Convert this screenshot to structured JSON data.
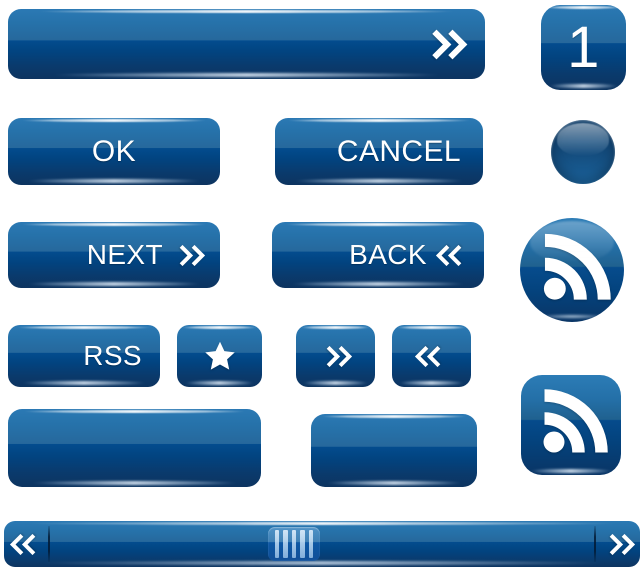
{
  "banner": {
    "label": "",
    "icon": "double-chevron-right-icon"
  },
  "buttons": {
    "ok": "OK",
    "cancel": "CANCEL",
    "next": "NEXT",
    "back": "BACK",
    "rss": "RSS",
    "star_icon": "star-icon",
    "forward_icon": "double-chevron-right-icon",
    "rewind_icon": "double-chevron-left-icon",
    "blank_wide": "",
    "blank_small": ""
  },
  "badge": {
    "number": "1"
  },
  "orb": {
    "label": "",
    "icon": "glossy-sphere-icon"
  },
  "rss_round": {
    "icon": "rss-feed-icon"
  },
  "rss_square": {
    "icon": "rss-feed-icon"
  },
  "scrollbar": {
    "left_icon": "double-chevron-left-icon",
    "right_icon": "double-chevron-right-icon",
    "grip_icon": "grip-lines-icon",
    "grip_bars": 5,
    "position_percent": 41
  },
  "colors": {
    "accent_light": "#2b79b4",
    "accent_mid": "#26689c",
    "accent_dark": "#034c8e",
    "accent_deep": "#0d3460",
    "text": "#ffffff",
    "background": "#ffffff"
  }
}
